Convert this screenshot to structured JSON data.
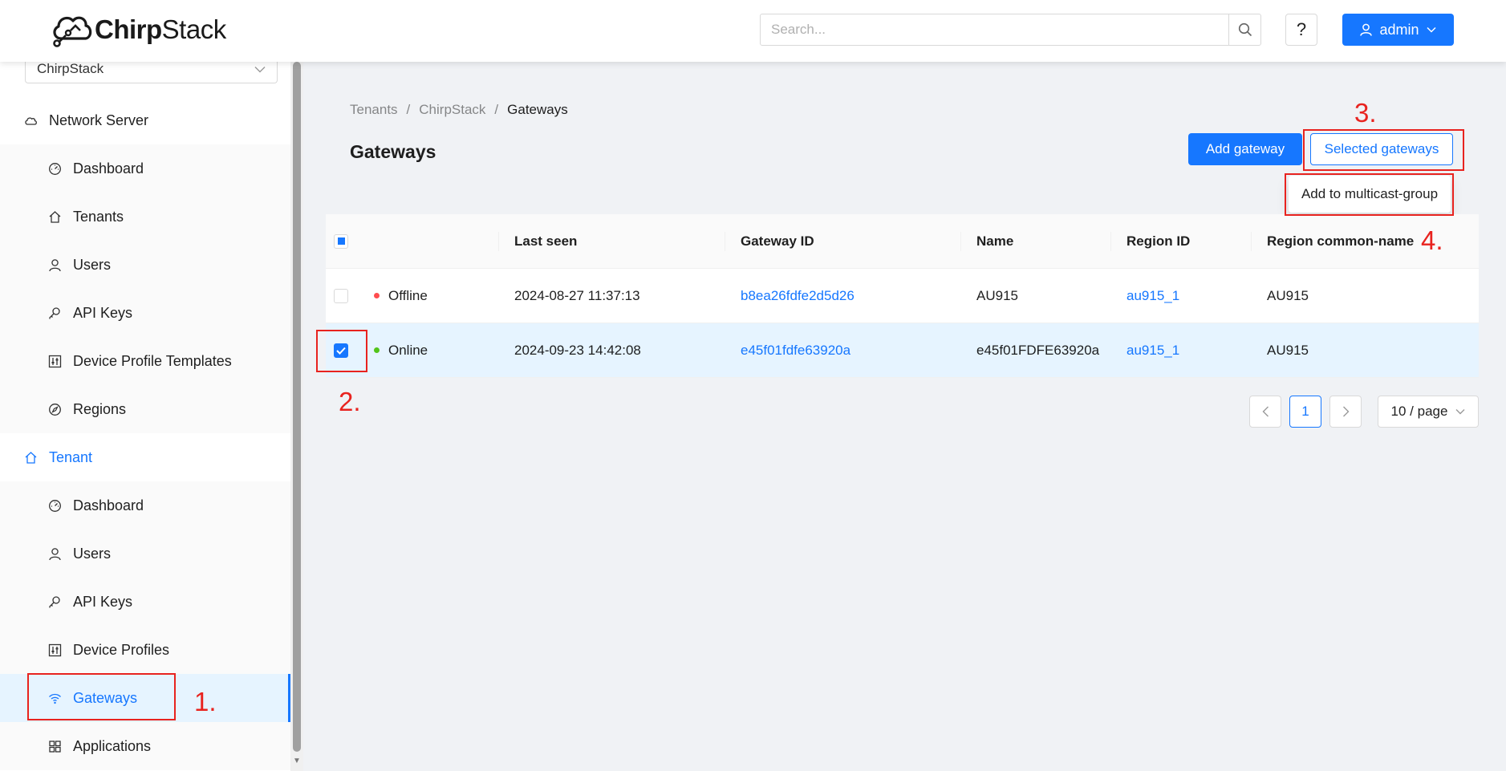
{
  "header": {
    "logo_text_bold": "Chirp",
    "logo_text_regular": "Stack",
    "search_placeholder": "Search...",
    "help_label": "?",
    "user_label": "admin"
  },
  "sidebar": {
    "tenant_select": "ChirpStack",
    "groups": [
      {
        "label": "Network Server",
        "items": [
          "Dashboard",
          "Tenants",
          "Users",
          "API Keys",
          "Device Profile Templates",
          "Regions"
        ]
      },
      {
        "label": "Tenant",
        "items": [
          "Dashboard",
          "Users",
          "API Keys",
          "Device Profiles",
          "Gateways",
          "Applications"
        ]
      }
    ],
    "selected_item": "Gateways"
  },
  "breadcrumb": [
    "Tenants",
    "ChirpStack",
    "Gateways"
  ],
  "page_title": "Gateways",
  "actions": {
    "add_gateway": "Add gateway",
    "selected_gateways": "Selected gateways",
    "dropdown_item": "Add to multicast-group"
  },
  "table": {
    "columns": [
      "Last seen",
      "Gateway ID",
      "Name",
      "Region ID",
      "Region common-name"
    ],
    "rows": [
      {
        "checked": false,
        "status": "Offline",
        "status_color": "#ff4d4f",
        "last_seen": "2024-08-27 11:37:13",
        "gateway_id": "b8ea26fdfe2d5d26",
        "name": "AU915",
        "region_id": "au915_1",
        "region_common_name": "AU915"
      },
      {
        "checked": true,
        "status": "Online",
        "status_color": "#52c41a",
        "last_seen": "2024-09-23 14:42:08",
        "gateway_id": "e45f01fdfe63920a",
        "name": "e45f01FDFE63920a",
        "region_id": "au915_1",
        "region_common_name": "AU915"
      }
    ]
  },
  "pagination": {
    "current_page": "1",
    "page_size": "10 / page"
  },
  "annotations": {
    "step1": "1.",
    "step2": "2.",
    "step3": "3.",
    "step4": "4."
  },
  "colors": {
    "primary": "#1677ff",
    "annotation": "#e8231f"
  }
}
